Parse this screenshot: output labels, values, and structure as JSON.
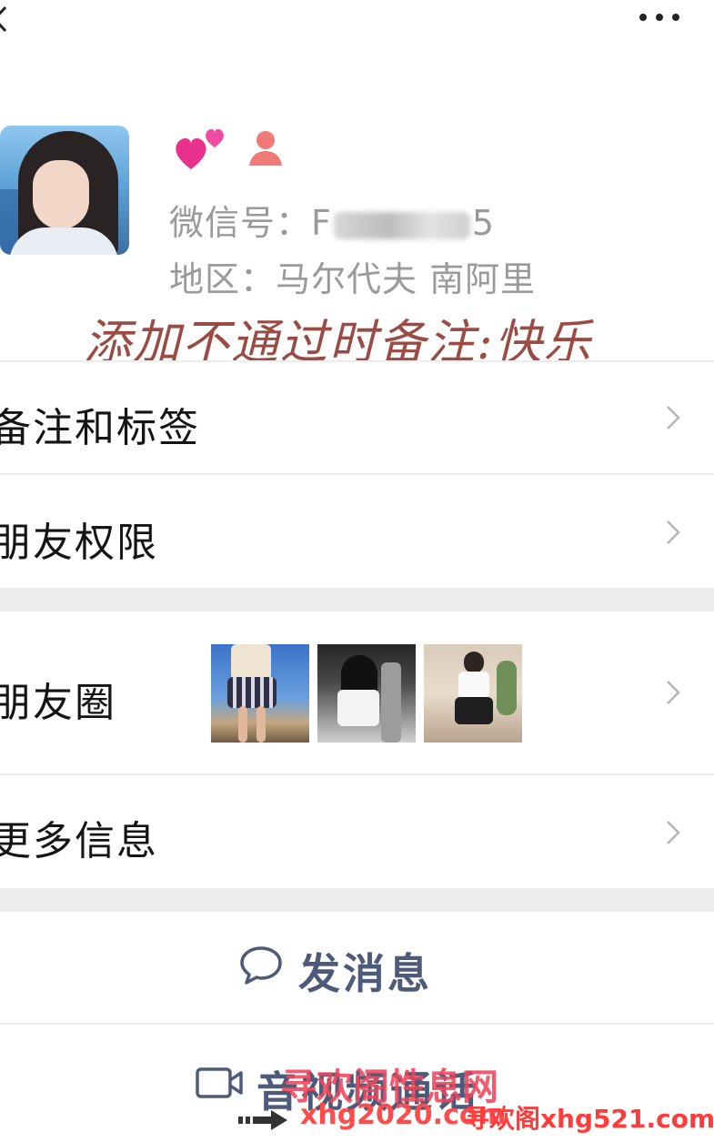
{
  "profile": {
    "wechat_id_prefix": "微信号：F",
    "wechat_id_suffix": "5",
    "region": "地区：马尔代夫 南阿里"
  },
  "remark_banner": "添加不通过时备注:快乐",
  "menu": {
    "remarks_tags": "备注和标签",
    "friend_permissions": "朋友权限",
    "moments": "朋友圈",
    "more_info": "更多信息"
  },
  "actions": {
    "send_message": "发消息",
    "video_call": "音视频通话"
  },
  "watermarks": {
    "center": "寻欢阁性息网",
    "url": "xhg2020.com",
    "right": "寻欢阁xhg521.com"
  },
  "colors": {
    "action_text": "#4d5a7a",
    "remark_banner": "#9a4b44",
    "watermark": "#ff3b3b"
  }
}
